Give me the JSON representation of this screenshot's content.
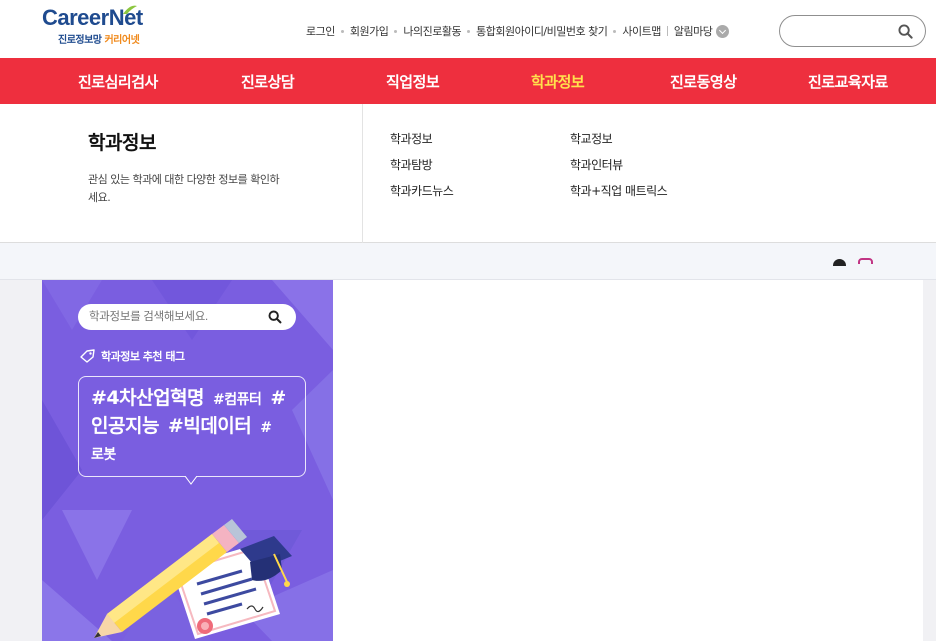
{
  "logo": {
    "word_a": "Career",
    "word_b": "N",
    "word_c": "et",
    "sub_a": "진로정보망",
    "sub_b": " 커리어넷"
  },
  "util_links": [
    "로그인",
    "회원가입",
    "나의진로활동",
    "통합회원아이디/비밀번호 찾기",
    "사이트맵",
    "알림마당"
  ],
  "search": {
    "placeholder": ""
  },
  "nav": {
    "tabs": [
      "진로심리검사",
      "진로상담",
      "직업정보",
      "학과정보",
      "진로동영상",
      "진로교육자료"
    ],
    "active": "학과정보",
    "active_color": "#ffe14d",
    "bar_color": "#ee2f3e"
  },
  "panel": {
    "title": "학과정보",
    "desc": "관심 있는 학과에 대한 다양한 정보를 확인하세요.",
    "links_col1": [
      "학과정보",
      "학과탐방",
      "학과카드뉴스"
    ],
    "links_col2": [
      "학교정보",
      "학과인터뷰",
      "학과+직업 매트릭스"
    ]
  },
  "promo": {
    "search_placeholder": "학과정보를 검색해보세요.",
    "tag_heading": "학과정보 추천 태그",
    "tag_rows": [
      {
        "size": "mixed",
        "tags": [
          "#4차산업혁명",
          "#컴퓨터",
          "#"
        ]
      },
      {
        "size": "mixed",
        "tags": [
          "인공지능",
          "#빅데이터",
          "#"
        ]
      },
      {
        "size": "small",
        "tags": [
          "로봇"
        ]
      }
    ],
    "bg_color": "#7a5ee0"
  },
  "icons": [
    "search-icon",
    "chevron-down-icon",
    "tag-icon",
    "pencil-icon",
    "graduation-cap-icon",
    "certificate-icon",
    "instagram-icon"
  ]
}
